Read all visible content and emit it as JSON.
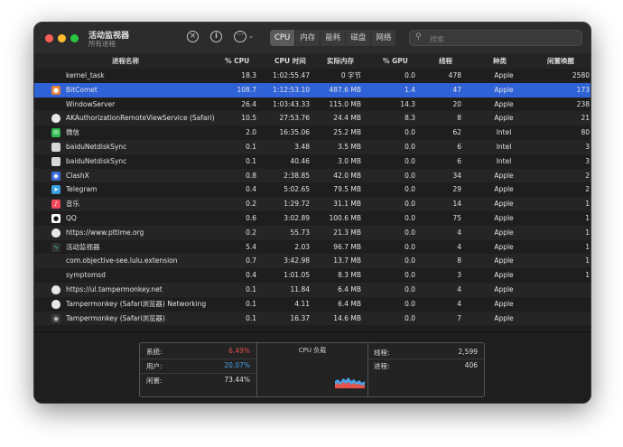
{
  "window": {
    "title": "活动监视器",
    "subtitle": "所有进程"
  },
  "toolbar": {
    "stop_glyph": "×",
    "info_glyph": "i",
    "more_glyph": "···",
    "chevron_glyph": "⌄",
    "tabs": [
      {
        "label": "CPU",
        "active": true
      },
      {
        "label": "内存",
        "active": false
      },
      {
        "label": "能耗",
        "active": false
      },
      {
        "label": "磁盘",
        "active": false
      },
      {
        "label": "网络",
        "active": false
      }
    ],
    "search_placeholder": "搜索",
    "search_icon": "magnifier-icon"
  },
  "columns": {
    "name": "进程名称",
    "cpu": "% CPU",
    "cpu_time": "CPU 时间",
    "real_mem": "实际内存",
    "gpu": "% GPU",
    "threads": "线程",
    "kind": "种类",
    "idle_wake": "闲置唤醒"
  },
  "processes": [
    {
      "icon": "none",
      "name": "kernel_task",
      "cpu": "18.3",
      "time": "1:02:55.47",
      "mem": "0 字节",
      "gpu": "0.0",
      "threads": "478",
      "kind": "Apple",
      "idle": "2580"
    },
    {
      "icon": "bitcomet-icon",
      "name": "BitComet",
      "cpu": "108.7",
      "time": "1:12:53.10",
      "mem": "487.6 MB",
      "gpu": "1.4",
      "threads": "47",
      "kind": "Apple",
      "idle": "173"
    },
    {
      "icon": "none",
      "name": "WindowServer",
      "cpu": "26.4",
      "time": "1:03:43.33",
      "mem": "115.0 MB",
      "gpu": "14.3",
      "threads": "20",
      "kind": "Apple",
      "idle": "238"
    },
    {
      "icon": "shield-icon",
      "name": "AKAuthorizationRemoteViewService (Safari)",
      "cpu": "10.5",
      "time": "27:53.76",
      "mem": "24.4 MB",
      "gpu": "8.3",
      "threads": "8",
      "kind": "Apple",
      "idle": "21"
    },
    {
      "icon": "wechat-icon",
      "name": "微信",
      "cpu": "2.0",
      "time": "16:35.06",
      "mem": "25.2 MB",
      "gpu": "0.0",
      "threads": "62",
      "kind": "Intel",
      "idle": "80"
    },
    {
      "icon": "document-icon",
      "name": "baiduNetdiskSync",
      "cpu": "0.1",
      "time": "3.48",
      "mem": "3.5 MB",
      "gpu": "0.0",
      "threads": "6",
      "kind": "Intel",
      "idle": "3"
    },
    {
      "icon": "document-icon",
      "name": "baiduNetdiskSync",
      "cpu": "0.1",
      "time": "40.46",
      "mem": "3.0 MB",
      "gpu": "0.0",
      "threads": "6",
      "kind": "Intel",
      "idle": "3"
    },
    {
      "icon": "clashx-icon",
      "name": "ClashX",
      "cpu": "0.8",
      "time": "2:38.85",
      "mem": "42.0 MB",
      "gpu": "0.0",
      "threads": "34",
      "kind": "Apple",
      "idle": "2"
    },
    {
      "icon": "telegram-icon",
      "name": "Telegram",
      "cpu": "0.4",
      "time": "5:02.65",
      "mem": "79.5 MB",
      "gpu": "0.0",
      "threads": "29",
      "kind": "Apple",
      "idle": "2"
    },
    {
      "icon": "music-icon",
      "name": "音乐",
      "cpu": "0.2",
      "time": "1:29.72",
      "mem": "31.1 MB",
      "gpu": "0.0",
      "threads": "14",
      "kind": "Apple",
      "idle": "1"
    },
    {
      "icon": "qq-icon",
      "name": "QQ",
      "cpu": "0.6",
      "time": "3:02.89",
      "mem": "100.6 MB",
      "gpu": "0.0",
      "threads": "75",
      "kind": "Apple",
      "idle": "1"
    },
    {
      "icon": "shield-icon",
      "name": "https://www.pttime.org",
      "cpu": "0.2",
      "time": "55.73",
      "mem": "21.3 MB",
      "gpu": "0.0",
      "threads": "4",
      "kind": "Apple",
      "idle": "1"
    },
    {
      "icon": "activity-monitor-icon",
      "name": "活动监视器",
      "cpu": "5.4",
      "time": "2.03",
      "mem": "96.7 MB",
      "gpu": "0.0",
      "threads": "4",
      "kind": "Apple",
      "idle": "1"
    },
    {
      "icon": "none",
      "name": "com.objective-see.lulu.extension",
      "cpu": "0.7",
      "time": "3:42.98",
      "mem": "13.7 MB",
      "gpu": "0.0",
      "threads": "8",
      "kind": "Apple",
      "idle": "1"
    },
    {
      "icon": "none",
      "name": "symptomsd",
      "cpu": "0.4",
      "time": "1:01.05",
      "mem": "8.3 MB",
      "gpu": "0.0",
      "threads": "3",
      "kind": "Apple",
      "idle": "1"
    },
    {
      "icon": "shield-icon",
      "name": "https://ul.tampermonkey.net",
      "cpu": "0.1",
      "time": "11.84",
      "mem": "6.4 MB",
      "gpu": "0.0",
      "threads": "4",
      "kind": "Apple",
      "idle": ""
    },
    {
      "icon": "shield-icon",
      "name": "Tampermonkey (Safari浏览器) Networking",
      "cpu": "0.1",
      "time": "4.11",
      "mem": "6.4 MB",
      "gpu": "0.0",
      "threads": "4",
      "kind": "Apple",
      "idle": ""
    },
    {
      "icon": "tampermonkey-icon",
      "name": "Tampermonkey (Safari浏览器)",
      "cpu": "0.1",
      "time": "16.37",
      "mem": "14.6 MB",
      "gpu": "0.0",
      "threads": "7",
      "kind": "Apple",
      "idle": ""
    }
  ],
  "summary": {
    "system_label": "系统:",
    "system_value": "6.49%",
    "system_color": "#e5534b",
    "user_label": "用户:",
    "user_value": "20.07%",
    "user_color": "#4aa3e8",
    "idle_label": "闲置:",
    "idle_value": "73.44%",
    "cpu_load_title": "CPU 负载",
    "threads_label": "线程:",
    "threads_value": "2,599",
    "procs_label": "进程:",
    "procs_value": "406"
  },
  "colors": {
    "selected_row": "#2f62d6",
    "accent": "#2f62d6"
  }
}
